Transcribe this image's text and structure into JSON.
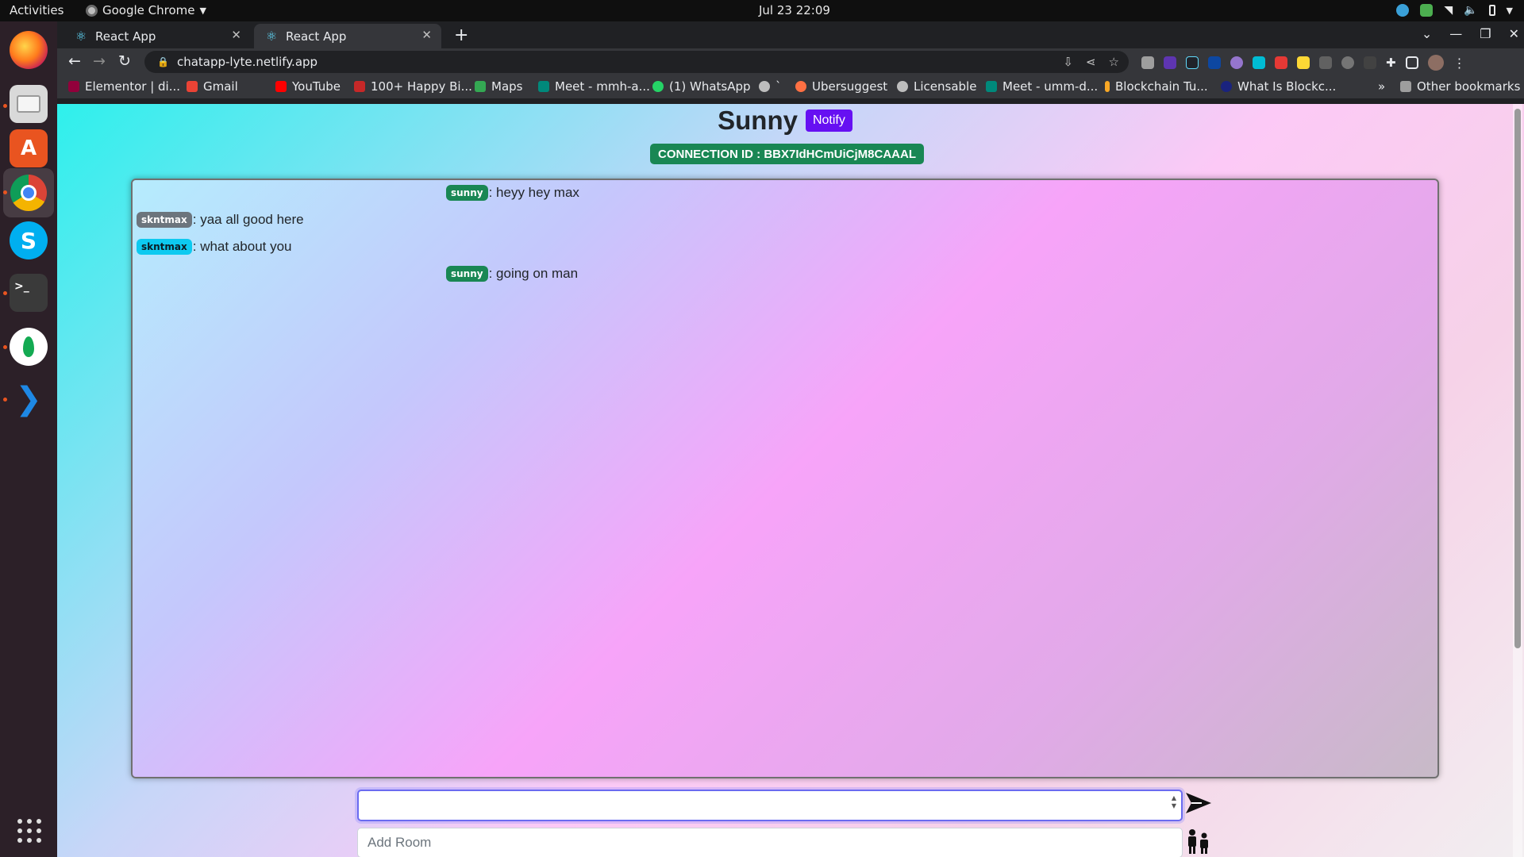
{
  "topbar": {
    "activities": "Activities",
    "app_name": "Google Chrome",
    "clock": "Jul 23  22:09"
  },
  "dock": {
    "items": [
      "firefox-icon",
      "files-icon",
      "app-center-icon",
      "chrome-icon",
      "skype-icon",
      "terminal-icon",
      "mongodb-compass-icon",
      "vscode-icon"
    ],
    "show_apps_icon": "grid-icon"
  },
  "tabs": [
    {
      "label": "React App",
      "active": false
    },
    {
      "label": "React App",
      "active": true
    }
  ],
  "toolbar": {
    "url": "chatapp-lyte.netlify.app"
  },
  "bookmarks": {
    "items": [
      "Elementor | di...",
      "Gmail",
      "YouTube",
      "100+ Happy Bi...",
      "Maps",
      "Meet - mmh-a...",
      "(1) WhatsApp",
      "`",
      "Ubersuggest",
      "Licensable",
      "Meet - umm-d...",
      "Blockchain Tu...",
      "What Is Blockc..."
    ],
    "overflow": "»",
    "other": "Other bookmarks"
  },
  "app": {
    "user_name": "Sunny",
    "notify_label": "Notify",
    "connection_id": "CONNECTION ID : BBX7IdHCmUiCjM8CAAAL",
    "messages": [
      {
        "sender": "sunny",
        "text": ": heyy hey max"
      },
      {
        "sender": "skntmax",
        "text": ": yaa all good here"
      },
      {
        "sender": "skntmax",
        "text": ": what about you"
      },
      {
        "sender": "sunny",
        "text": ": going on man"
      }
    ],
    "message_value": "",
    "room_placeholder": "Add Room"
  },
  "colors": {
    "sunny_badge": "#198754",
    "skntmax_badge_1": "#6c757d",
    "skntmax_badge_2": "#0dcaf0",
    "notify_button": "#6610f2"
  }
}
